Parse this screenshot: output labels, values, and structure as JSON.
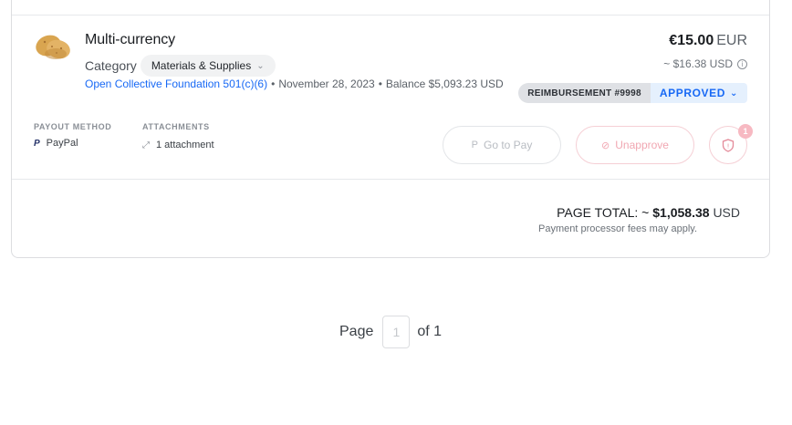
{
  "expense": {
    "title": "Multi-currency",
    "category_label": "Category",
    "category_value": "Materials & Supplies",
    "host_link": "Open Collective Foundation 501(c)(6)",
    "date": "November 28, 2023",
    "balance": "Balance $5,093.23 USD",
    "amount": "€15.00",
    "currency": "EUR",
    "converted": "~ $16.38 USD",
    "reference": "REIMBURSEMENT #9998",
    "status": "APPROVED",
    "payout_method_label": "PAYOUT METHOD",
    "payout_method_value": "PayPal",
    "attachments_label": "ATTACHMENTS",
    "attachments_value": "1 attachment",
    "go_to_pay": "Go to Pay",
    "unapprove": "Unapprove",
    "security_count": "1"
  },
  "totals": {
    "label": "PAGE TOTAL: ~",
    "amount": "$1,058.38",
    "currency": "USD",
    "note": "Payment processor fees may apply."
  },
  "pagination": {
    "page_label": "Page",
    "current": "1",
    "of_label": "of 1"
  },
  "colors": {
    "link": "#1869f5",
    "approved_bg": "#e5f0fd",
    "unapprove": "#f1a7b2",
    "badge_bg": "#dfe1e5"
  },
  "icons": [
    "potato-avatar-icon",
    "chevron-down-icon",
    "info-icon",
    "paypal-icon",
    "expand-icon",
    "paypal-pay-icon",
    "ban-icon",
    "shield-icon"
  ]
}
